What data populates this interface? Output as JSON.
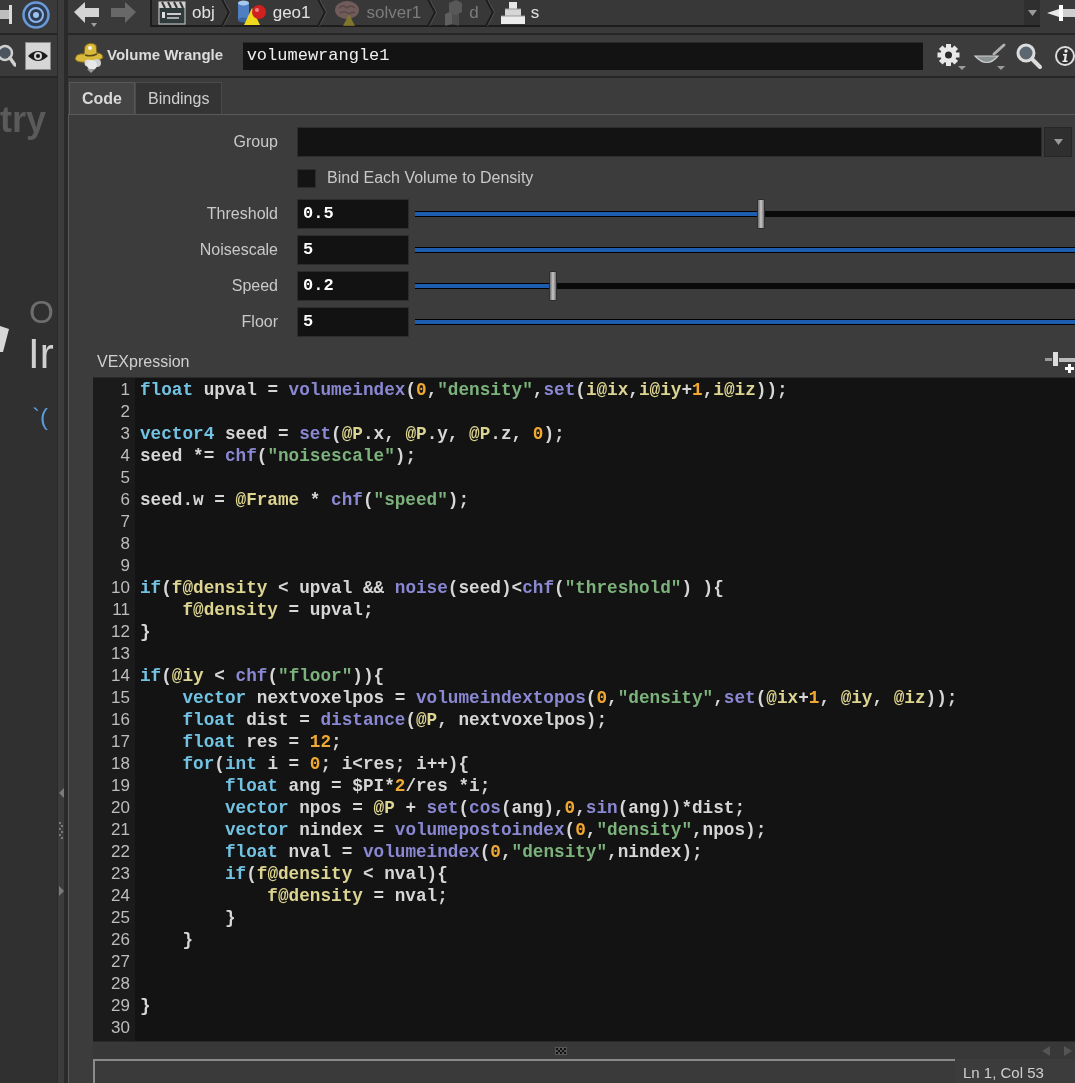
{
  "left_panel": {
    "title_fragment": "try",
    "label_fragment": "O",
    "heading_fragment": "Ir",
    "mark_fragment": "`("
  },
  "navigation": {
    "back": {
      "disabled": false
    },
    "forward": {
      "disabled": true
    }
  },
  "breadcrumb": {
    "items": [
      {
        "kind": "clapperboard",
        "label": "obj",
        "dimmed": false
      },
      {
        "kind": "shapes",
        "label": "geo1",
        "dimmed": false
      },
      {
        "kind": "brain",
        "label": "solver1",
        "dimmed": true
      },
      {
        "kind": "blocks",
        "label": "d",
        "dimmed": true
      },
      {
        "kind": "stack",
        "label": "s",
        "dimmed": false
      }
    ]
  },
  "node": {
    "type_label": "Volume Wrangle",
    "name": "volumewrangle1"
  },
  "tabs": [
    {
      "label": "Code",
      "selected": true
    },
    {
      "label": "Bindings",
      "selected": false
    }
  ],
  "parameters": {
    "group": {
      "label": "Group"
    },
    "bind_toggle": {
      "label": "Bind Each Volume to Density",
      "checked": false
    },
    "sliders": [
      {
        "label": "Threshold",
        "value": "0.5",
        "level": 0.524
      },
      {
        "label": "Noisescale",
        "value": "5",
        "level": 1
      },
      {
        "label": "Speed",
        "value": "0.2",
        "level": 0.209
      },
      {
        "label": "Floor",
        "value": "5",
        "level": 1
      }
    ]
  },
  "vexpression": {
    "label": "VEXpression",
    "lines": [
      {
        "number": "1",
        "tokens": [
          {
            "kind": "keyword",
            "text": "float"
          },
          {
            "kind": "plain",
            "text": " upval = "
          },
          {
            "kind": "function",
            "text": "volumeindex"
          },
          {
            "kind": "plain",
            "text": "("
          },
          {
            "kind": "number",
            "text": "0"
          },
          {
            "kind": "plain",
            "text": ","
          },
          {
            "kind": "string",
            "text": "\"density\""
          },
          {
            "kind": "plain",
            "text": ","
          },
          {
            "kind": "function",
            "text": "set"
          },
          {
            "kind": "plain",
            "text": "("
          },
          {
            "kind": "attribute",
            "text": "i@ix"
          },
          {
            "kind": "plain",
            "text": ","
          },
          {
            "kind": "attribute",
            "text": "i@iy"
          },
          {
            "kind": "plain",
            "text": "+"
          },
          {
            "kind": "number",
            "text": "1"
          },
          {
            "kind": "plain",
            "text": ","
          },
          {
            "kind": "attribute",
            "text": "i@iz"
          },
          {
            "kind": "plain",
            "text": "));"
          }
        ]
      },
      {
        "number": "2"
      },
      {
        "number": "3",
        "tokens": [
          {
            "kind": "keyword",
            "text": "vector4"
          },
          {
            "kind": "plain",
            "text": " seed = "
          },
          {
            "kind": "function",
            "text": "set"
          },
          {
            "kind": "plain",
            "text": "("
          },
          {
            "kind": "attribute",
            "text": "@P"
          },
          {
            "kind": "plain",
            "text": ".x, "
          },
          {
            "kind": "attribute",
            "text": "@P"
          },
          {
            "kind": "plain",
            "text": ".y, "
          },
          {
            "kind": "attribute",
            "text": "@P"
          },
          {
            "kind": "plain",
            "text": ".z, "
          },
          {
            "kind": "number",
            "text": "0"
          },
          {
            "kind": "plain",
            "text": ");"
          }
        ]
      },
      {
        "number": "4",
        "tokens": [
          {
            "kind": "plain",
            "text": "seed *= "
          },
          {
            "kind": "function",
            "text": "chf"
          },
          {
            "kind": "plain",
            "text": "("
          },
          {
            "kind": "string",
            "text": "\"noisescale\""
          },
          {
            "kind": "plain",
            "text": ");"
          }
        ]
      },
      {
        "number": "5"
      },
      {
        "number": "6",
        "tokens": [
          {
            "kind": "plain",
            "text": "seed.w = "
          },
          {
            "kind": "attribute",
            "text": "@Frame"
          },
          {
            "kind": "plain",
            "text": " * "
          },
          {
            "kind": "function",
            "text": "chf"
          },
          {
            "kind": "plain",
            "text": "("
          },
          {
            "kind": "string",
            "text": "\"speed\""
          },
          {
            "kind": "plain",
            "text": ");"
          }
        ]
      },
      {
        "number": "7"
      },
      {
        "number": "8"
      },
      {
        "number": "9"
      },
      {
        "number": "10",
        "tokens": [
          {
            "kind": "keyword",
            "text": "if"
          },
          {
            "kind": "plain",
            "text": "("
          },
          {
            "kind": "attribute",
            "text": "f@density"
          },
          {
            "kind": "plain",
            "text": " < upval && "
          },
          {
            "kind": "function",
            "text": "noise"
          },
          {
            "kind": "plain",
            "text": "(seed)<"
          },
          {
            "kind": "function",
            "text": "chf"
          },
          {
            "kind": "plain",
            "text": "("
          },
          {
            "kind": "string",
            "text": "\"threshold\""
          },
          {
            "kind": "plain",
            "text": ") ){"
          }
        ]
      },
      {
        "number": "11",
        "tokens": [
          {
            "kind": "attribute",
            "text": "    f@density"
          },
          {
            "kind": "plain",
            "text": " = upval;"
          }
        ]
      },
      {
        "number": "12",
        "tokens": [
          {
            "kind": "plain",
            "text": "}"
          }
        ]
      },
      {
        "number": "13"
      },
      {
        "number": "14",
        "tokens": [
          {
            "kind": "keyword",
            "text": "if"
          },
          {
            "kind": "plain",
            "text": "("
          },
          {
            "kind": "attribute",
            "text": "@iy"
          },
          {
            "kind": "plain",
            "text": " < "
          },
          {
            "kind": "function",
            "text": "chf"
          },
          {
            "kind": "plain",
            "text": "("
          },
          {
            "kind": "string",
            "text": "\"floor\""
          },
          {
            "kind": "plain",
            "text": ")){"
          }
        ]
      },
      {
        "number": "15",
        "tokens": [
          {
            "kind": "keyword",
            "text": "    vector"
          },
          {
            "kind": "plain",
            "text": " nextvoxelpos = "
          },
          {
            "kind": "function",
            "text": "volumeindextopos"
          },
          {
            "kind": "plain",
            "text": "("
          },
          {
            "kind": "number",
            "text": "0"
          },
          {
            "kind": "plain",
            "text": ","
          },
          {
            "kind": "string",
            "text": "\"density\""
          },
          {
            "kind": "plain",
            "text": ","
          },
          {
            "kind": "function",
            "text": "set"
          },
          {
            "kind": "plain",
            "text": "("
          },
          {
            "kind": "attribute",
            "text": "@ix"
          },
          {
            "kind": "plain",
            "text": "+"
          },
          {
            "kind": "number",
            "text": "1"
          },
          {
            "kind": "plain",
            "text": ", "
          },
          {
            "kind": "attribute",
            "text": "@iy"
          },
          {
            "kind": "plain",
            "text": ", "
          },
          {
            "kind": "attribute",
            "text": "@iz"
          },
          {
            "kind": "plain",
            "text": "));"
          }
        ]
      },
      {
        "number": "16",
        "tokens": [
          {
            "kind": "keyword",
            "text": "    float"
          },
          {
            "kind": "plain",
            "text": " dist = "
          },
          {
            "kind": "function",
            "text": "distance"
          },
          {
            "kind": "plain",
            "text": "("
          },
          {
            "kind": "attribute",
            "text": "@P"
          },
          {
            "kind": "plain",
            "text": ", nextvoxelpos);"
          }
        ]
      },
      {
        "number": "17",
        "tokens": [
          {
            "kind": "keyword",
            "text": "    float"
          },
          {
            "kind": "plain",
            "text": " res = "
          },
          {
            "kind": "number",
            "text": "12"
          },
          {
            "kind": "plain",
            "text": ";"
          }
        ]
      },
      {
        "number": "18",
        "tokens": [
          {
            "kind": "keyword",
            "text": "    for"
          },
          {
            "kind": "plain",
            "text": "("
          },
          {
            "kind": "keyword",
            "text": "int"
          },
          {
            "kind": "plain",
            "text": " i = "
          },
          {
            "kind": "number",
            "text": "0"
          },
          {
            "kind": "plain",
            "text": "; i<res; i++){"
          }
        ]
      },
      {
        "number": "19",
        "tokens": [
          {
            "kind": "keyword",
            "text": "        float"
          },
          {
            "kind": "plain",
            "text": " ang = $PI*"
          },
          {
            "kind": "number",
            "text": "2"
          },
          {
            "kind": "plain",
            "text": "/res *i;"
          }
        ]
      },
      {
        "number": "20",
        "tokens": [
          {
            "kind": "keyword",
            "text": "        vector"
          },
          {
            "kind": "plain",
            "text": " npos = "
          },
          {
            "kind": "attribute",
            "text": "@P"
          },
          {
            "kind": "plain",
            "text": " + "
          },
          {
            "kind": "function",
            "text": "set"
          },
          {
            "kind": "plain",
            "text": "("
          },
          {
            "kind": "function",
            "text": "cos"
          },
          {
            "kind": "plain",
            "text": "(ang),"
          },
          {
            "kind": "number",
            "text": "0"
          },
          {
            "kind": "plain",
            "text": ","
          },
          {
            "kind": "function",
            "text": "sin"
          },
          {
            "kind": "plain",
            "text": "(ang))*dist;"
          }
        ]
      },
      {
        "number": "21",
        "tokens": [
          {
            "kind": "keyword",
            "text": "        vector"
          },
          {
            "kind": "plain",
            "text": " nindex = "
          },
          {
            "kind": "function",
            "text": "volumepostoindex"
          },
          {
            "kind": "plain",
            "text": "("
          },
          {
            "kind": "number",
            "text": "0"
          },
          {
            "kind": "plain",
            "text": ","
          },
          {
            "kind": "string",
            "text": "\"density\""
          },
          {
            "kind": "plain",
            "text": ",npos);"
          }
        ]
      },
      {
        "number": "22",
        "tokens": [
          {
            "kind": "keyword",
            "text": "        float"
          },
          {
            "kind": "plain",
            "text": " nval = "
          },
          {
            "kind": "function",
            "text": "volumeindex"
          },
          {
            "kind": "plain",
            "text": "("
          },
          {
            "kind": "number",
            "text": "0"
          },
          {
            "kind": "plain",
            "text": ","
          },
          {
            "kind": "string",
            "text": "\"density\""
          },
          {
            "kind": "plain",
            "text": ",nindex);"
          }
        ]
      },
      {
        "number": "23",
        "tokens": [
          {
            "kind": "keyword",
            "text": "        if"
          },
          {
            "kind": "plain",
            "text": "("
          },
          {
            "kind": "attribute",
            "text": "f@density"
          },
          {
            "kind": "plain",
            "text": " < nval){"
          }
        ]
      },
      {
        "number": "24",
        "tokens": [
          {
            "kind": "attribute",
            "text": "            f@density"
          },
          {
            "kind": "plain",
            "text": " = nval;"
          }
        ]
      },
      {
        "number": "25",
        "tokens": [
          {
            "kind": "plain",
            "text": "        }"
          }
        ]
      },
      {
        "number": "26",
        "tokens": [
          {
            "kind": "plain",
            "text": "    }"
          }
        ]
      },
      {
        "number": "27"
      },
      {
        "number": "28"
      },
      {
        "number": "29",
        "tokens": [
          {
            "kind": "plain",
            "text": "}"
          }
        ]
      },
      {
        "number": "30"
      }
    ]
  },
  "status_bar": {
    "position": "Ln 1, Col 53"
  }
}
